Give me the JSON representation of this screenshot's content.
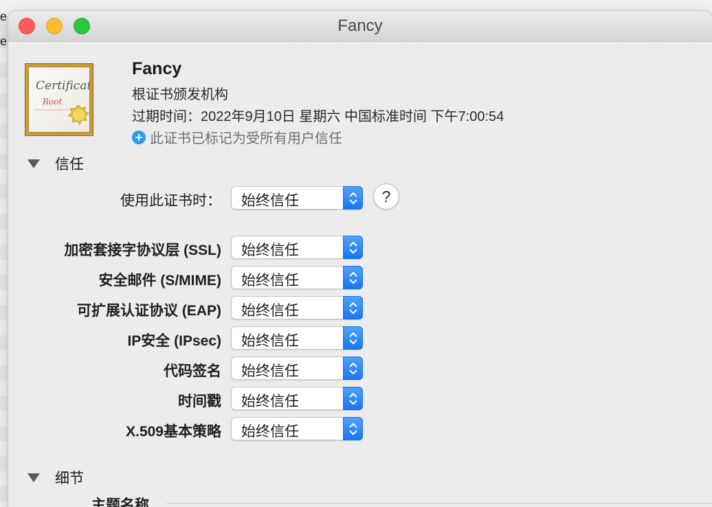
{
  "background": {
    "letters": [
      "e",
      "e"
    ]
  },
  "window": {
    "title": "Fancy"
  },
  "certificate": {
    "image_text": {
      "line1": "Certificate",
      "line2": "Root"
    },
    "name": "Fancy",
    "kind": "根证书颁发机构",
    "expiry": "过期时间：2022年9月10日 星期六 中国标准时间 下午7:00:54",
    "status": "此证书已标记为受所有用户信任",
    "status_icon": "plus-circle-icon"
  },
  "trust": {
    "heading": "信任",
    "when_using_label": "使用此证书时：",
    "when_using_value": "始终信任",
    "help": "?",
    "policies": [
      {
        "label": "加密套接字协议层 (SSL)",
        "value": "始终信任"
      },
      {
        "label": "安全邮件 (S/MIME)",
        "value": "始终信任"
      },
      {
        "label": "可扩展认证协议 (EAP)",
        "value": "始终信任"
      },
      {
        "label": "IP安全 (IPsec)",
        "value": "始终信任"
      },
      {
        "label": "代码签名",
        "value": "始终信任"
      },
      {
        "label": "时间戳",
        "value": "始终信任"
      },
      {
        "label": "X.509基本策略",
        "value": "始终信任"
      }
    ]
  },
  "details": {
    "heading": "细节",
    "subject_name_label": "主题名称"
  },
  "colors": {
    "accent": "#1877f2",
    "plus": "#2d9bf0"
  }
}
